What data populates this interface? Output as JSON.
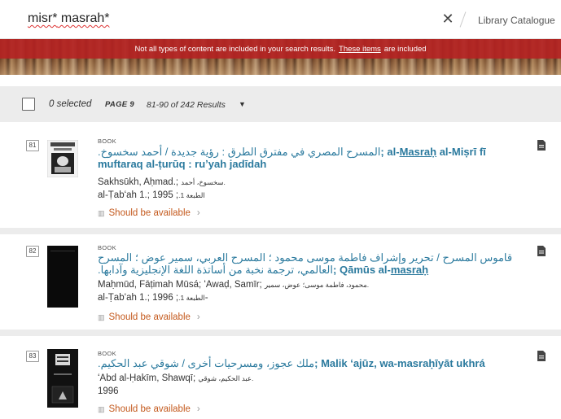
{
  "search": {
    "query_part1": "misr*",
    "query_part2": " masrah*",
    "clear_icon": "close-icon",
    "scope": "Library Catalogue"
  },
  "banner": {
    "notice_text": "Not all types of content are included in your search results.",
    "link_text": "These items",
    "notice_suffix": "are included",
    "color": "#b22222"
  },
  "toolbar": {
    "selected": "0 selected",
    "page": "PAGE 9",
    "range": "81-90 of 242 Results",
    "caret": "▼"
  },
  "accent": {
    "title": "#2b7a9e",
    "availability": "#c45a1e"
  },
  "records": [
    {
      "num": "81",
      "type": "BOOK",
      "title_ar": "المسرح المصري في مفترق الطرق : رؤية جديدة / أحمد سخسوخ.",
      "title_sep": ";",
      "title_lat_pre": "al-",
      "title_lat_hl": "Masraḥ",
      "title_lat_post": " al-Miṣrī fī muftaraq al-ṭurūq : ruʼyah jadīdah",
      "author": "Sakhsūkh, Aḥmad.;",
      "author_ar": "سخسوخ، أحمد.",
      "edition": "al-Ṭabʻah 1.;",
      "edition_ar": "الطبعة 1.",
      "year": "; 1995",
      "availability": "Should be available",
      "doc_icon": "document-icon"
    },
    {
      "num": "82",
      "type": "BOOK",
      "title_ar": "قاموس المسرح / تحرير وإشراف فاطمة موسى محمود ؛ المسرح العربي، سمير عوض ؛ المسرح العالمي، ترجمة نخبة من أساتذة اللغة الإنجليزية وآدابها.",
      "title_sep": ";",
      "title_lat_pre": "Qāmūs al-",
      "title_lat_hl": "masraḥ",
      "title_lat_post": "",
      "author": "Maḥmūd, Fāṭimah Mūsá; ʻAwaḍ, Samīr;",
      "author_ar": "محمود، فاطمة موسى؛ عوض، سمير.",
      "edition": "al-Ṭabʻah 1.;",
      "edition_ar": "الطبعة 1.",
      "year": "; 1996-",
      "availability": "Should be available",
      "doc_icon": "document-icon"
    },
    {
      "num": "83",
      "type": "BOOK",
      "title_ar": "ملك عجوز، ومسرحيات أخرى / شوقي عبد الحكيم.",
      "title_sep": ";",
      "title_lat_pre": "Malik ʻajūz, wa-",
      "title_lat_hl": "masraḥ",
      "title_lat_post": "īyāt ukhrá",
      "author": "ʻAbd al-Ḥakīm, Shawqī;",
      "author_ar": "عبد الحكيم، شوقي.",
      "edition": "",
      "edition_ar": "",
      "year": "1996",
      "availability": "Should be available",
      "doc_icon": "document-icon"
    }
  ]
}
